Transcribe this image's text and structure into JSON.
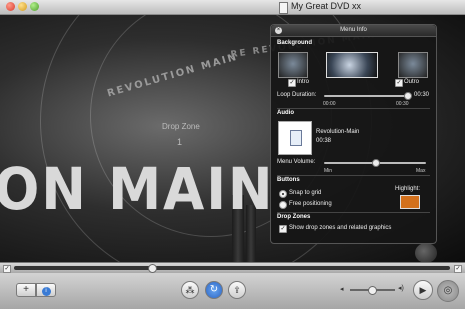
{
  "window": {
    "title": "My Great DVD xx"
  },
  "stage": {
    "background_text": "ON MAIN",
    "background_banner": "REVOLUTION MAIN",
    "background_banner2": "RE REVOLUTION MAIN",
    "drop_zone_label": "Drop Zone",
    "drop_zone_number": "1"
  },
  "inspector": {
    "title": "Menu Info",
    "background": {
      "heading": "Background",
      "intro_label": "Intro",
      "intro_checked": true,
      "outro_label": "Outro",
      "outro_checked": true
    },
    "loop": {
      "label": "Loop Duration:",
      "value": "00:30",
      "min_label": "00:00",
      "max_label": "00:30",
      "level_fraction": 1.0
    },
    "audio": {
      "heading": "Audio",
      "track_name": "Revolution-Main",
      "track_duration": "00:38"
    },
    "volume": {
      "label": "Menu Volume:",
      "min_label": "Min",
      "max_label": "Max",
      "level_fraction": 0.5
    },
    "buttons": {
      "heading": "Buttons",
      "snap_label": "Snap to grid",
      "free_label": "Free positioning",
      "selected": "snap",
      "highlight_label": "Highlight:",
      "highlight_color": "#d2701c"
    },
    "drop_zones": {
      "heading": "Drop Zones",
      "show_label": "Show drop zones and related graphics",
      "show_checked": true
    }
  },
  "toolbar": {
    "add_button": "+",
    "info_button": "i"
  },
  "colors": {
    "accent": "#d2701c",
    "selection_blue": "#3a7bd5"
  }
}
